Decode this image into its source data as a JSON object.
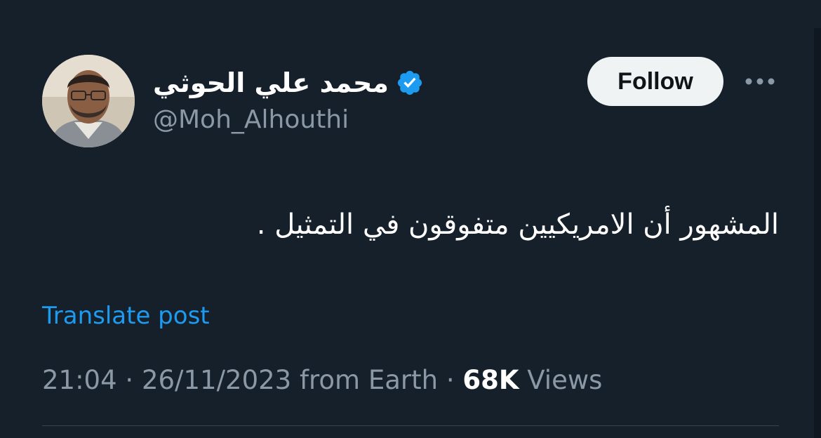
{
  "author": {
    "display_name": "محمد علي الحوثي",
    "handle": "@Moh_Alhouthi",
    "verified_icon": "verified-badge-icon",
    "avatar_icon": "avatar-photo"
  },
  "actions": {
    "follow_label": "Follow",
    "more_icon": "more-dots-icon"
  },
  "tweet": {
    "text": "المشهور أن الامريكيين متفوقون في التمثيل .",
    "translate_label": "Translate post"
  },
  "meta": {
    "time": "21:04",
    "separator": "·",
    "date": "26/11/2023",
    "source": "from Earth",
    "views_count": "68K",
    "views_label": "Views"
  },
  "colors": {
    "background": "#15202b",
    "accent": "#1d9bf0",
    "secondary_text": "#8b98a5",
    "follow_bg": "#eff3f4"
  }
}
